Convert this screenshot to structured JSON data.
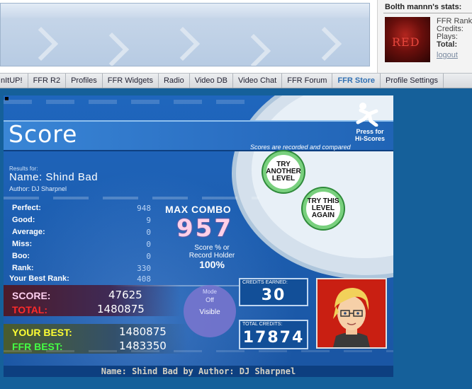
{
  "stats": {
    "title": "Bolth mannn's stats:",
    "labels": [
      "FFR Rank:",
      "Credits:",
      "Plays:",
      "Total:"
    ],
    "logout": "logout",
    "thumb_text": "RED"
  },
  "nav": {
    "items": [
      "nItUP!",
      "FFR R2",
      "Profiles",
      "FFR Widgets",
      "Radio",
      "Video DB",
      "Video Chat",
      "FFR Forum",
      "FFR Store",
      "Profile Settings"
    ],
    "active": "FFR Store"
  },
  "game": {
    "heading": "Score",
    "press_line1": "Press for",
    "press_line2": "Hi-Scores",
    "recorded": "Scores are recorded and compared",
    "results_for": "Results for:",
    "song_name": "Name: Shind Bad",
    "author": "Author: DJ Sharpnel",
    "try_another": [
      "TRY",
      "ANOTHER",
      "LEVEL"
    ],
    "try_again": [
      "TRY THIS",
      "LEVEL",
      "AGAIN"
    ],
    "stats": [
      {
        "label": "Perfect:",
        "value": "948"
      },
      {
        "label": "Good:",
        "value": "9"
      },
      {
        "label": "Average:",
        "value": "0"
      },
      {
        "label": "Miss:",
        "value": "0"
      },
      {
        "label": "Boo:",
        "value": "0"
      },
      {
        "label": "Rank:",
        "value": "330"
      }
    ],
    "best_rank_label": "Your Best Rank:",
    "best_rank_value": "408",
    "max_combo_label": "MAX COMBO",
    "max_combo_value": "957",
    "score_pct_line1": "Score % or",
    "score_pct_line2": "Record Holder",
    "score_pct_value": "100%",
    "score_label": "SCORE:",
    "score_value": "47625",
    "total_label": "TOTAL:",
    "total_value": "1480875",
    "your_best_label": "YOUR BEST:",
    "your_best_value": "1480875",
    "ffr_best_label": "FFR BEST:",
    "ffr_best_value": "1483350",
    "visible_top": "Mode",
    "visible_off": "Off",
    "visible_label": "Visible",
    "credits_earned_label": "CREDITS EARNED:",
    "credits_earned_value": "30",
    "total_credits_label": "TOTAL CREDITS:",
    "total_credits_value": "17874",
    "footer": "Name: Shind Bad by Author: DJ Sharpnel"
  },
  "colors": {
    "page_bg": "#15609a",
    "score_label": "#ffd0f0",
    "total_label": "#ff2a2a",
    "your_best_label": "#ffff33",
    "ffr_best_label": "#44ff44",
    "nav_active": "#2f6fb2",
    "try_button_ring": "#79d07e"
  }
}
